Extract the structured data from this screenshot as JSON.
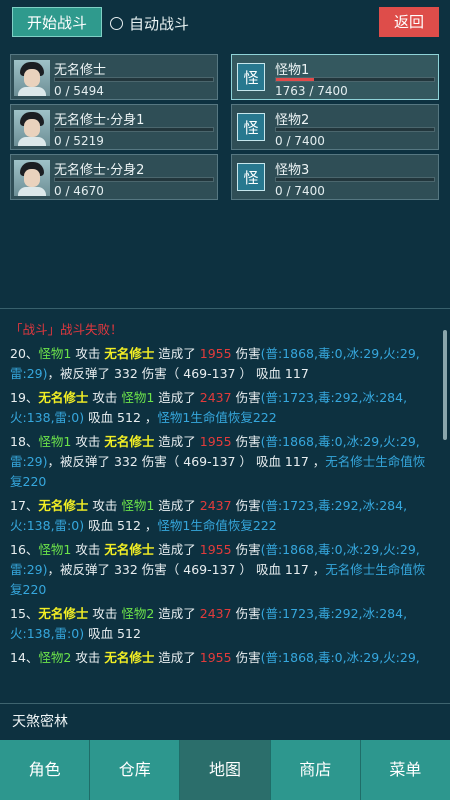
{
  "header": {
    "start_label": "开始战斗",
    "auto_label": "自动战斗",
    "back_label": "返回"
  },
  "heroes": [
    {
      "name": "无名修士",
      "hp": "0 / 5494"
    },
    {
      "name": "无名修士·分身1",
      "hp": "0 / 5219"
    },
    {
      "name": "无名修士·分身2",
      "hp": "0 / 4670"
    }
  ],
  "monsters": [
    {
      "icon": "怪",
      "name": "怪物1",
      "hp": "1763 / 7400",
      "hp_fraction": 0.24
    },
    {
      "icon": "怪",
      "name": "怪物2",
      "hp": "0 / 7400",
      "hp_fraction": 0
    },
    {
      "icon": "怪",
      "name": "怪物3",
      "hp": "0 / 7400",
      "hp_fraction": 0
    }
  ],
  "log": {
    "title": "「战斗」战斗失败！",
    "entries": [
      {
        "num": "20、",
        "attacker": "怪物1",
        "attacker_role": "monster",
        "verb": " 攻击 ",
        "target": "无名修士",
        "target_role": "hero",
        "made": " 造成了 ",
        "dmg": "1955",
        "detail": " 伤害",
        "detail2": "(普:1868,毒:0,冰:29,火:29,雷:29)",
        "rest": "，被反弹了 332 伤害（ 469-137 ） 吸血 117",
        "rest_blue": ""
      },
      {
        "num": "19、",
        "attacker": "无名修士",
        "attacker_role": "hero",
        "verb": " 攻击 ",
        "target": "怪物1",
        "target_role": "monster",
        "made": " 造成了 ",
        "dmg": "2437",
        "detail": " 伤害",
        "detail2": "(普:1723,毒:292,冰:284,火:138,雷:0)",
        "rest": " 吸血 512 ，",
        "rest_blue": "怪物1生命值恢复222"
      },
      {
        "num": "18、",
        "attacker": "怪物1",
        "attacker_role": "monster",
        "verb": " 攻击 ",
        "target": "无名修士",
        "target_role": "hero",
        "made": " 造成了 ",
        "dmg": "1955",
        "detail": " 伤害",
        "detail2": "(普:1868,毒:0,冰:29,火:29,雷:29)",
        "rest": "，被反弹了 332 伤害（ 469-137 ） 吸血 117 ，",
        "rest_blue": "无名修士生命值恢复220"
      },
      {
        "num": "17、",
        "attacker": "无名修士",
        "attacker_role": "hero",
        "verb": " 攻击 ",
        "target": "怪物1",
        "target_role": "monster",
        "made": " 造成了 ",
        "dmg": "2437",
        "detail": " 伤害",
        "detail2": "(普:1723,毒:292,冰:284,火:138,雷:0)",
        "rest": " 吸血 512 ，",
        "rest_blue": "怪物1生命值恢复222"
      },
      {
        "num": "16、",
        "attacker": "怪物1",
        "attacker_role": "monster",
        "verb": " 攻击 ",
        "target": "无名修士",
        "target_role": "hero",
        "made": " 造成了 ",
        "dmg": "1955",
        "detail": " 伤害",
        "detail2": "(普:1868,毒:0,冰:29,火:29,雷:29)",
        "rest": "，被反弹了 332 伤害（ 469-137 ） 吸血 117 ，",
        "rest_blue": "无名修士生命值恢复220"
      },
      {
        "num": "15、",
        "attacker": "无名修士",
        "attacker_role": "hero",
        "verb": " 攻击 ",
        "target": "怪物2",
        "target_role": "monster",
        "made": " 造成了 ",
        "dmg": "2437",
        "detail": " 伤害",
        "detail2": "(普:1723,毒:292,冰:284,火:138,雷:0)",
        "rest": " 吸血 512",
        "rest_blue": ""
      },
      {
        "num": "14、",
        "attacker": "怪物2",
        "attacker_role": "monster",
        "verb": " 攻击 ",
        "target": "无名修士",
        "target_role": "hero",
        "made": " 造成了 ",
        "dmg": "1955",
        "detail": " 伤害",
        "detail2": "(普:1868,毒:0,冰:29,火:29,",
        "rest": "",
        "rest_blue": ""
      }
    ]
  },
  "location": "天煞密林",
  "nav": [
    {
      "label": "角色"
    },
    {
      "label": "仓库"
    },
    {
      "label": "地图"
    },
    {
      "label": "商店"
    },
    {
      "label": "菜单"
    }
  ],
  "colors": {
    "accent": "#2d978e",
    "danger": "#de4d4a",
    "hero_text": "#f2ee24",
    "monster_text": "#6ce34a",
    "damage_text": "#e23b3b",
    "info_text": "#36a7dd"
  }
}
